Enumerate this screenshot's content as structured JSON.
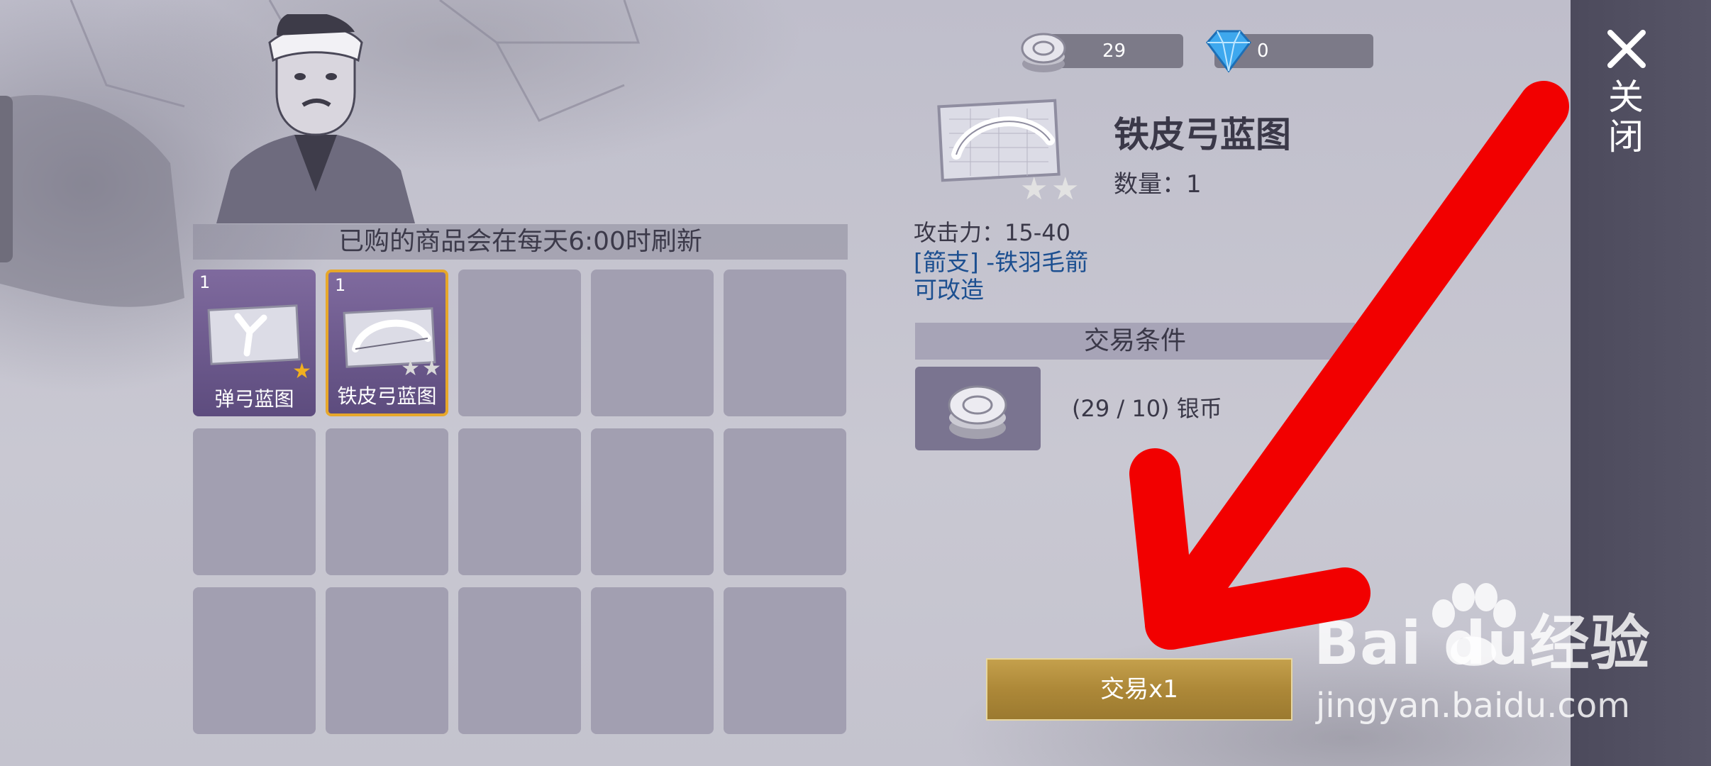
{
  "currency": {
    "silver_amount": "29",
    "gem_amount": "0"
  },
  "shop": {
    "refresh_notice": "已购的商品会在每天6:00时刷新",
    "slots": [
      {
        "count": "1",
        "name": "弹弓蓝图",
        "stars": 1,
        "star_color": "#f2b01e"
      },
      {
        "count": "1",
        "name": "铁皮弓蓝图",
        "stars": 2,
        "star_color": "#d8d8d8"
      }
    ]
  },
  "detail": {
    "title": "铁皮弓蓝图",
    "quantity": "数量：1",
    "attack": "攻击力：15-40",
    "ammo_link": "[箭支] -铁羽毛箭",
    "modifiable_link": "可改造",
    "conditions_header": "交易条件",
    "condition_text": "(29 / 10) 银币"
  },
  "actions": {
    "trade_label": "交易x1",
    "close_label": "关闭"
  },
  "watermark": {
    "brand": "Bai  du经验",
    "url": "jingyan.baidu.com"
  },
  "colors": {
    "accent_gold": "#e7a72a",
    "link_blue": "#1c4f90",
    "annotation_arrow": "#f20000"
  }
}
